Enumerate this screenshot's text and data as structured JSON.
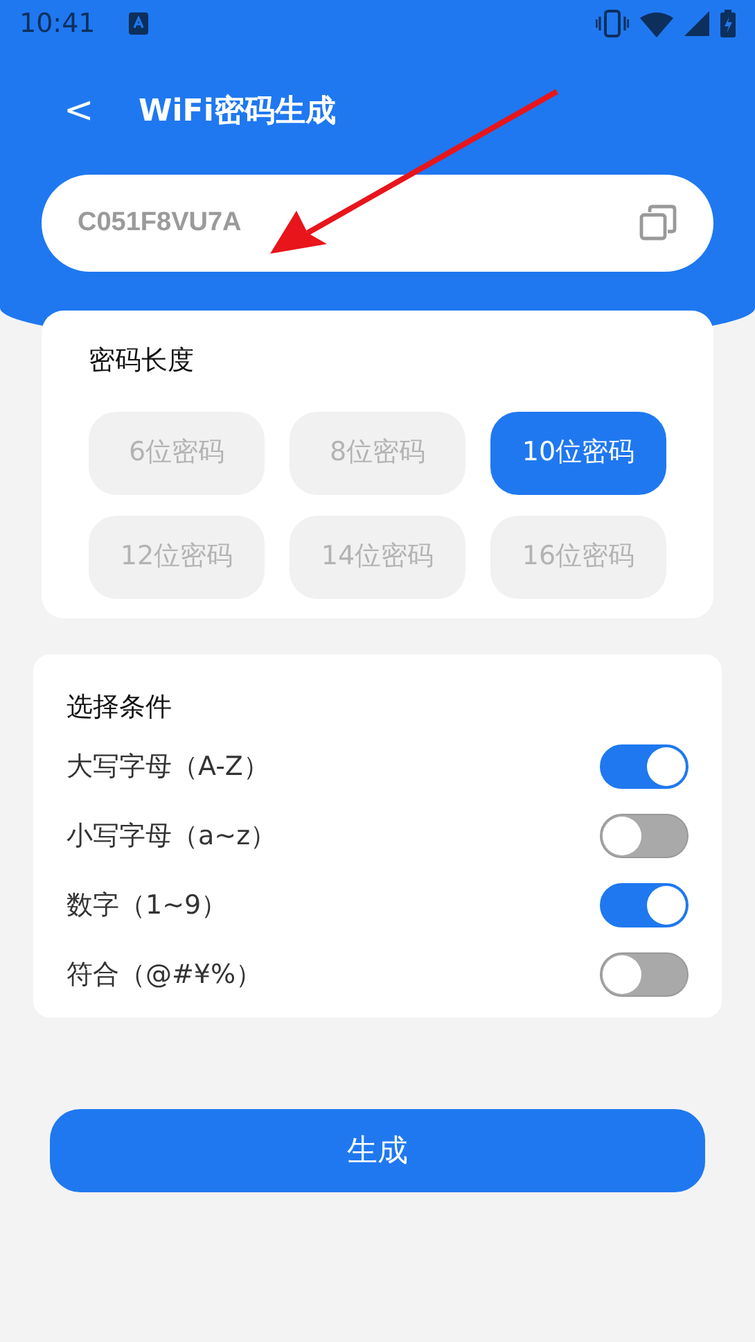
{
  "status_bar": {
    "time": "10:41"
  },
  "header": {
    "back": "<",
    "title": "WiFi密码生成"
  },
  "password": {
    "value": "C051F8VU7A"
  },
  "length_card": {
    "title": "密码长度",
    "options": [
      {
        "label": "6位密码",
        "selected": false
      },
      {
        "label": "8位密码",
        "selected": false
      },
      {
        "label": "10位密码",
        "selected": true
      },
      {
        "label": "12位密码",
        "selected": false
      },
      {
        "label": "14位密码",
        "selected": false
      },
      {
        "label": "16位密码",
        "selected": false
      }
    ]
  },
  "conditions_card": {
    "title": "选择条件",
    "items": [
      {
        "label": "大写字母（A-Z）",
        "on": true
      },
      {
        "label": "小写字母（a~z）",
        "on": false
      },
      {
        "label": "数字（1~9）",
        "on": true
      },
      {
        "label": "符合（@#¥%）",
        "on": false
      }
    ]
  },
  "generate_button": "生成"
}
